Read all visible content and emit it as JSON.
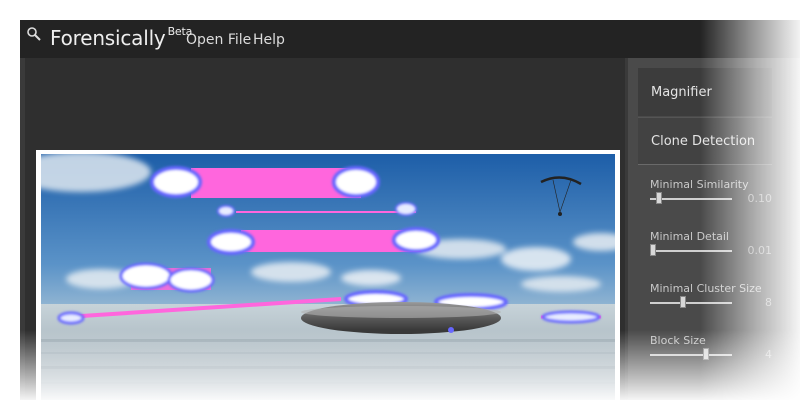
{
  "app": {
    "title": "Forensically",
    "title_suffix": "Beta",
    "icon": "magnifier-icon"
  },
  "menu": {
    "open_file": "Open File",
    "help": "Help"
  },
  "panel": {
    "magnifier": "Magnifier",
    "clone_detection": "Clone Detection",
    "sliders": [
      {
        "label": "Minimal Similarity",
        "value": "0.10",
        "level": 0.08
      },
      {
        "label": "Minimal Detail",
        "value": "0.01",
        "level": 0.0
      },
      {
        "label": "Minimal Cluster Size",
        "value": "8",
        "level": 0.4
      },
      {
        "label": "Block Size",
        "value": "4",
        "level": 0.7
      }
    ]
  },
  "colors": {
    "accent_clone": "#ff66dd",
    "highlight_blue": "#6666ff",
    "menubar": "#232323",
    "panel": "#4a4a4a"
  }
}
